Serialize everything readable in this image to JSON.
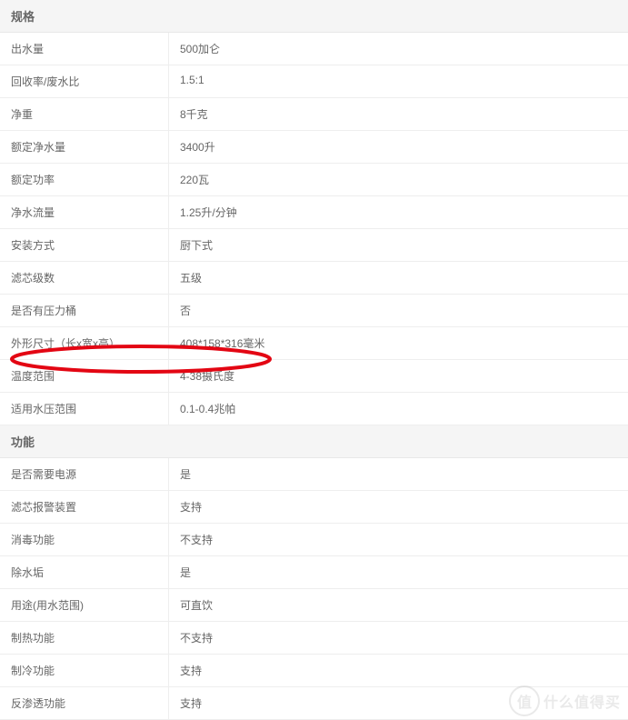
{
  "sections": {
    "specs": {
      "title": "规格",
      "rows": [
        {
          "label": "出水量",
          "value": "500加仑"
        },
        {
          "label": "回收率/废水比",
          "value": "1.5:1"
        },
        {
          "label": "净重",
          "value": "8千克"
        },
        {
          "label": "额定净水量",
          "value": "3400升"
        },
        {
          "label": "额定功率",
          "value": "220瓦"
        },
        {
          "label": "净水流量",
          "value": "1.25升/分钟"
        },
        {
          "label": "安装方式",
          "value": "厨下式"
        },
        {
          "label": "滤芯级数",
          "value": "五级"
        },
        {
          "label": "是否有压力桶",
          "value": "否"
        },
        {
          "label": "外形尺寸（长x宽x高）",
          "value": "408*158*316毫米"
        },
        {
          "label": "温度范围",
          "value": "4-38摄氏度"
        },
        {
          "label": "适用水压范围",
          "value": "0.1-0.4兆帕"
        }
      ]
    },
    "features": {
      "title": "功能",
      "rows": [
        {
          "label": "是否需要电源",
          "value": "是"
        },
        {
          "label": "滤芯报警装置",
          "value": "支持"
        },
        {
          "label": "消毒功能",
          "value": "不支持"
        },
        {
          "label": "除水垢",
          "value": "是"
        },
        {
          "label": "用途(用水范围)",
          "value": "可直饮"
        },
        {
          "label": "制热功能",
          "value": "不支持"
        },
        {
          "label": "制冷功能",
          "value": "支持"
        },
        {
          "label": "反渗透功能",
          "value": "支持"
        }
      ]
    }
  },
  "watermark": {
    "badge": "值",
    "text": "什么值得买"
  }
}
